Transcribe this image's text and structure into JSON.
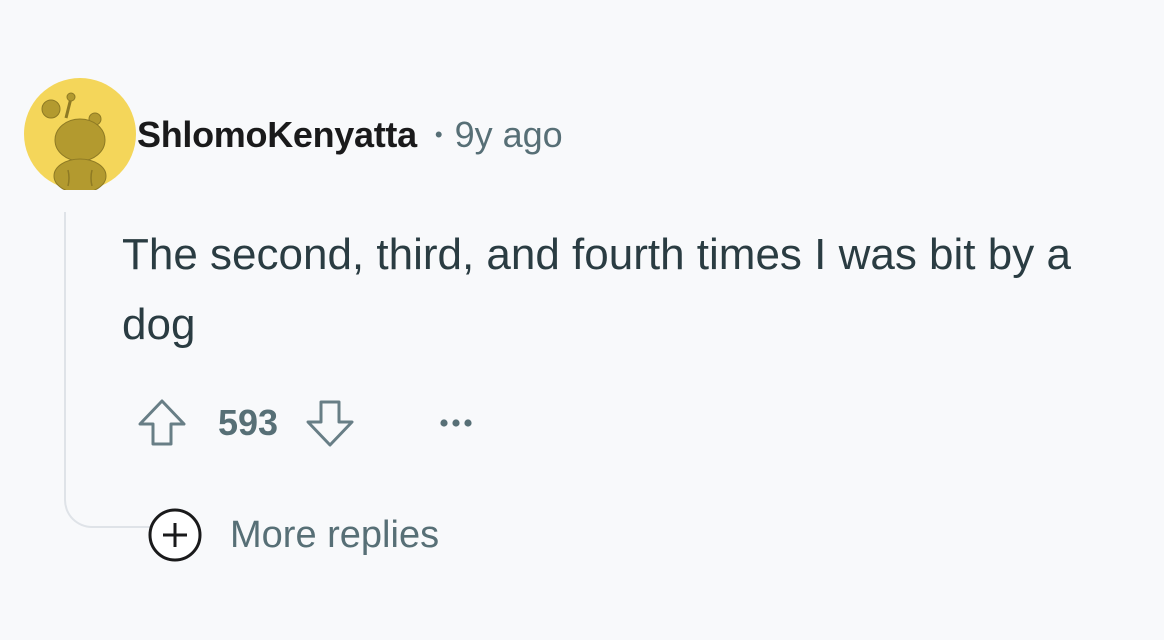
{
  "comment": {
    "author": "ShlomoKenyatta",
    "separator": "•",
    "timestamp": "9y ago",
    "body": "The second, third, and fourth times I was bit by a dog",
    "score": "593",
    "avatar_icon": "snoo-avatar-icon",
    "avatar_color": "#f4d65a"
  },
  "actions": {
    "upvote_icon": "upvote-arrow-icon",
    "downvote_icon": "downvote-arrow-icon",
    "overflow_icon": "ellipsis-icon"
  },
  "thread": {
    "more_replies_label": "More replies",
    "more_replies_icon": "plus-circle-icon"
  }
}
